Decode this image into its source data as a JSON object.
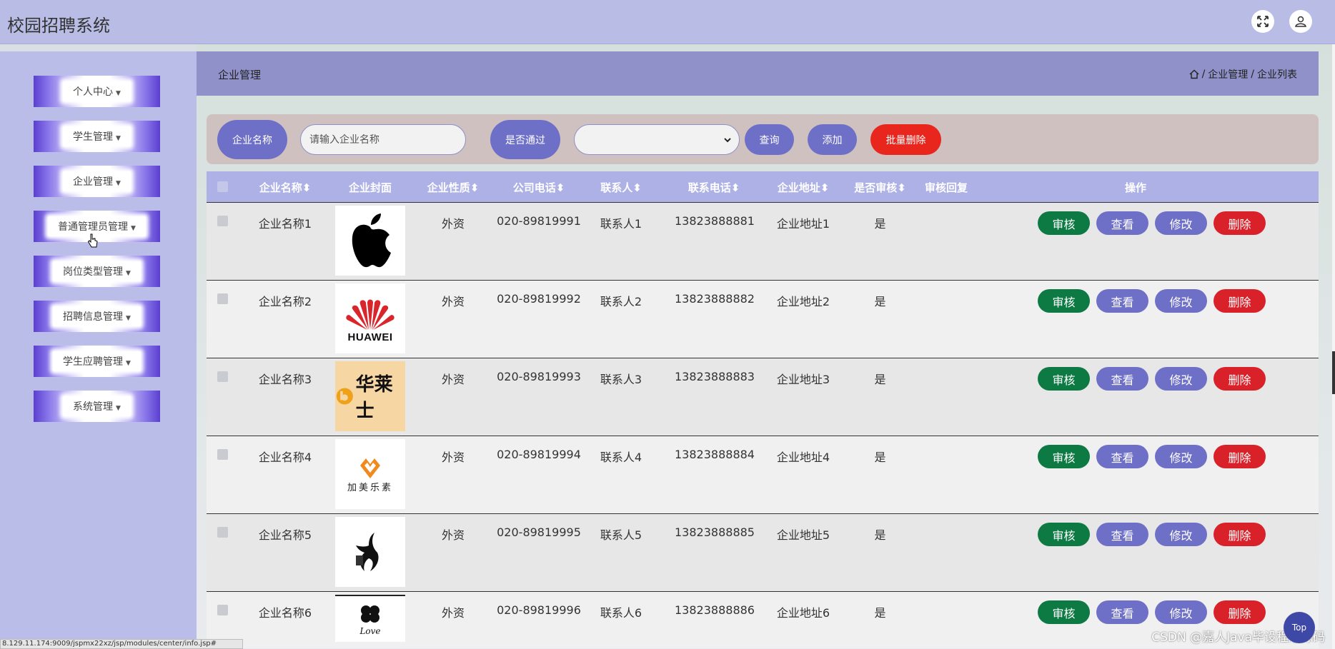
{
  "header": {
    "title": "校园招聘系统",
    "fullscreen_icon": "expand-arrows-icon",
    "user_icon": "user-icon"
  },
  "sidebar": {
    "items": [
      {
        "label": "个人中心"
      },
      {
        "label": "学生管理"
      },
      {
        "label": "企业管理"
      },
      {
        "label": "普通管理员管理"
      },
      {
        "label": "岗位类型管理"
      },
      {
        "label": "招聘信息管理"
      },
      {
        "label": "学生应聘管理"
      },
      {
        "label": "系统管理"
      }
    ]
  },
  "page": {
    "title": "企业管理",
    "breadcrumb": [
      "企业管理",
      "企业列表"
    ],
    "home_icon": "home-icon"
  },
  "search": {
    "name_label": "企业名称",
    "name_placeholder": "请输入企业名称",
    "passed_label": "是否通过",
    "passed_value": "",
    "query_button": "查询",
    "add_button": "添加",
    "batch_delete_button": "批量删除"
  },
  "table": {
    "headers": [
      "企业名称",
      "企业封面",
      "企业性质",
      "公司电话",
      "联系人",
      "联系电话",
      "企业地址",
      "是否审核",
      "审核回复",
      "操作"
    ],
    "actions": [
      "审核",
      "查看",
      "修改",
      "删除"
    ],
    "rows": [
      {
        "name": "企业名称1",
        "cover": "apple-logo",
        "nature": "外资",
        "phone": "020-89819991",
        "contact": "联系人1",
        "mobile": "13823888881",
        "address": "企业地址1",
        "audited": "是",
        "reply": ""
      },
      {
        "name": "企业名称2",
        "cover": "huawei-logo",
        "cover_text": "HUAWEI",
        "nature": "外资",
        "phone": "020-89819992",
        "contact": "联系人2",
        "mobile": "13823888882",
        "address": "企业地址2",
        "audited": "是",
        "reply": ""
      },
      {
        "name": "企业名称3",
        "cover": "hualaishi-logo",
        "cover_text": "华莱士",
        "nature": "外资",
        "phone": "020-89819993",
        "contact": "联系人3",
        "mobile": "13823888883",
        "address": "企业地址3",
        "audited": "是",
        "reply": ""
      },
      {
        "name": "企业名称4",
        "cover": "jiameilesu-logo",
        "cover_text": "加美乐素",
        "nature": "外资",
        "phone": "020-89819994",
        "contact": "联系人4",
        "mobile": "13823888884",
        "address": "企业地址4",
        "audited": "是",
        "reply": ""
      },
      {
        "name": "企业名称5",
        "cover": "bird-logo",
        "nature": "外资",
        "phone": "020-89819995",
        "contact": "联系人5",
        "mobile": "13823888885",
        "address": "企业地址5",
        "audited": "是",
        "reply": ""
      },
      {
        "name": "企业名称6",
        "cover": "clover-logo",
        "cover_text": "Love",
        "nature": "外资",
        "phone": "020-89819996",
        "contact": "联系人6",
        "mobile": "13823888886",
        "address": "企业地址6",
        "audited": "是",
        "reply": ""
      }
    ]
  },
  "status_url": "8.129.11.174:9009/jspmx22xz/jsp/modules/center/info.jsp#",
  "watermark": "CSDN @嘉人Java毕设程序源码",
  "top_button": "Top",
  "colors": {
    "header_bg": "#b9bde6",
    "sidebar_bg": "#b9bde8",
    "accent": "#6e6fc7",
    "audit_green": "#0d7a44",
    "delete_red": "#d9212a"
  }
}
